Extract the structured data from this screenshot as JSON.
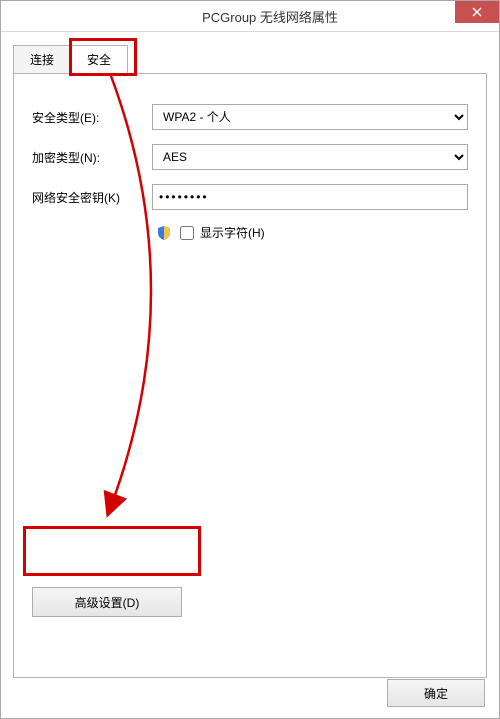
{
  "window": {
    "title": "PCGroup 无线网络属性"
  },
  "tabs": {
    "connect": "连接",
    "security": "安全"
  },
  "form": {
    "security_type_label": "安全类型(E):",
    "security_type_value": "WPA2 - 个人",
    "encryption_label": "加密类型(N):",
    "encryption_value": "AES",
    "key_label": "网络安全密钥(K)",
    "key_value": "••••••••",
    "show_chars_label": "显示字符(H)",
    "advanced_button": "高级设置(D)"
  },
  "footer": {
    "ok": "确定"
  }
}
